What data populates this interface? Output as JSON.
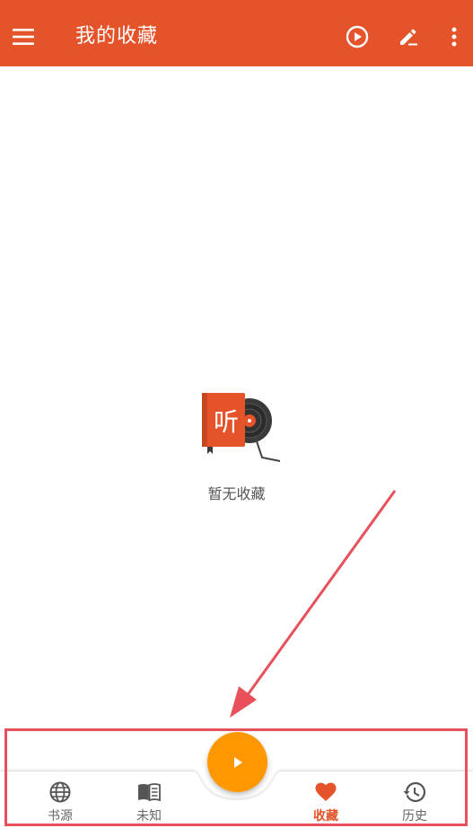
{
  "app_bar": {
    "title": "我的收藏",
    "icons": [
      "menu-icon",
      "play-circle-icon",
      "edit-icon",
      "more-vert-icon"
    ]
  },
  "empty_state": {
    "logo_glyph": "听",
    "message": "暂无收藏"
  },
  "bottom_nav": {
    "items": [
      {
        "label": "书源",
        "icon": "globe-icon",
        "active": false
      },
      {
        "label": "未知",
        "icon": "book-icon",
        "active": false
      },
      {
        "label": "收藏",
        "icon": "heart-icon",
        "active": true
      },
      {
        "label": "历史",
        "icon": "history-icon",
        "active": false
      }
    ],
    "fab_icon": "play-icon"
  },
  "colors": {
    "primary": "#e5532a",
    "fab": "#ff9800",
    "annotation": "#e8505b"
  }
}
